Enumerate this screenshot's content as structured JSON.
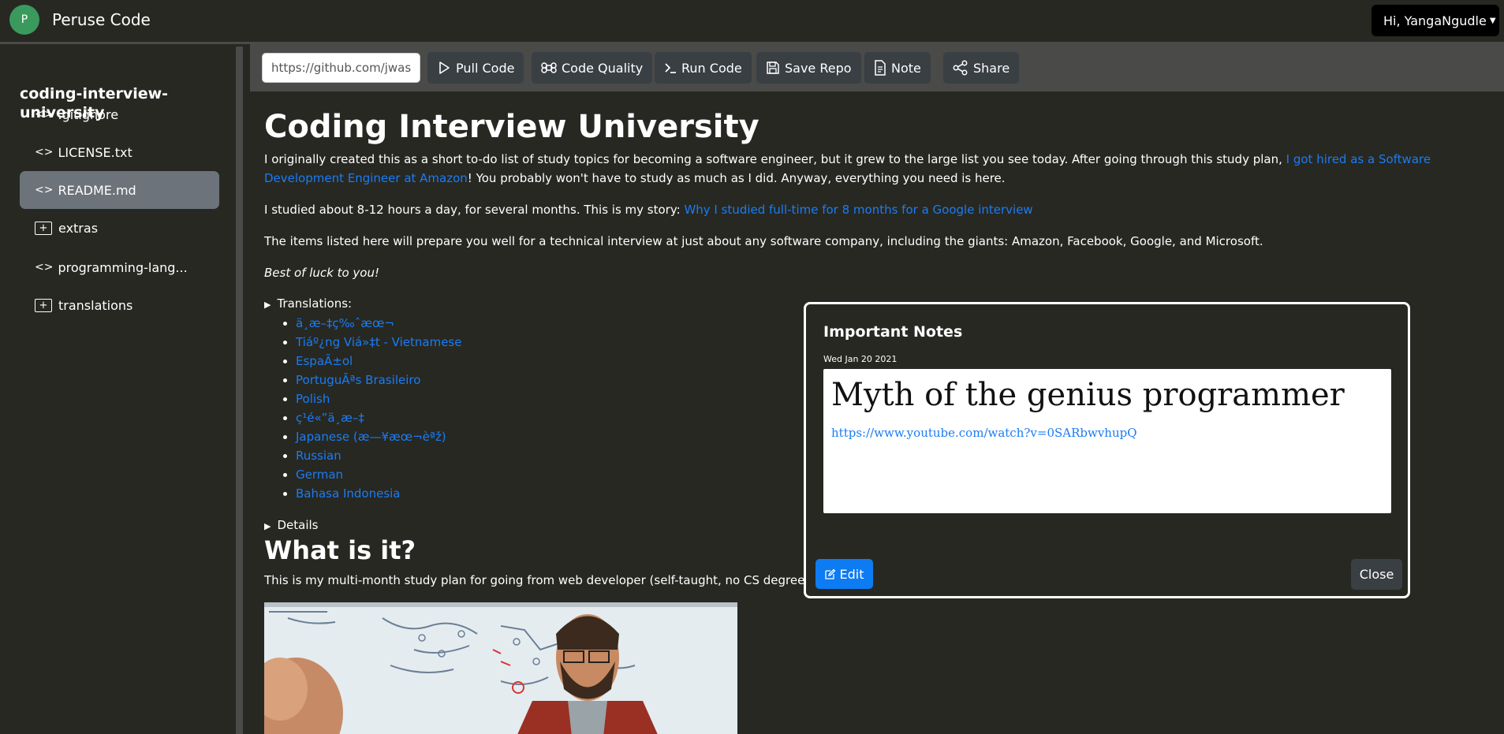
{
  "navbar": {
    "avatar_initial": "P",
    "brand": "Peruse Code",
    "user_label": "Hi, YangaNgudle"
  },
  "sidebar": {
    "repo_title": "coding-interview-university",
    "items": [
      {
        "label": ".gitignore",
        "type": "file"
      },
      {
        "label": "LICENSE.txt",
        "type": "file"
      },
      {
        "label": "README.md",
        "type": "file",
        "active": true
      },
      {
        "label": "extras",
        "type": "folder"
      },
      {
        "label": "programming-lang...",
        "type": "file"
      },
      {
        "label": "translations",
        "type": "folder"
      }
    ]
  },
  "toolbar": {
    "url_value": "https://github.com/jwasham/coding-interview-university",
    "buttons": [
      "Pull Code",
      "Code Quality",
      "Run Code",
      "Save Repo",
      "Note",
      "Share"
    ]
  },
  "readme": {
    "title": "Coding Interview University",
    "p1_text": "I originally created this as a short to-do list of study topics for becoming a software engineer, but it grew to the large list you see today. After going through this study plan, ",
    "p1_link": "I got hired as a Software Development Engineer at Amazon",
    "p1_tail": "! You probably won't have to study as much as I did. Anyway, everything you need is here.",
    "p2_text": "I studied about 8-12 hours a day, for several months. This is my story: ",
    "p2_link": "Why I studied full-time for 8 months for a Google interview",
    "p3_text": "The items listed here will prepare you well for a technical interview at just about any software company, including the giants: Amazon, Facebook, Google, and Microsoft.",
    "p4_text": "Best of luck to you!",
    "translations_summary": "Translations:",
    "translations": [
      "ä¸­æ–‡ç‰ˆæœ¬",
      "Tiáº¿ng Viá»‡t - Vietnamese",
      "EspaÃ±ol",
      "PortuguÃªs Brasileiro",
      "Polish",
      "ç¹é«”ä¸­æ–‡",
      "Japanese (æ—¥æœ¬èªž)",
      "Russian",
      "German",
      "Bahasa Indonesia"
    ],
    "details_summary": "Details",
    "h2": "What is it?",
    "p5_text": "This is my multi-month study plan for going from web developer (self-taught, no CS degree) to so"
  },
  "modal": {
    "title": "Important Notes",
    "date": "Wed Jan 20 2021",
    "note_heading": "Myth of the genius programmer",
    "note_link": "https://www.youtube.com/watch?v=0SARbwvhupQ",
    "edit_label": "Edit",
    "close_label": "Close"
  },
  "colors": {
    "background": "#272822",
    "toolbar": "#4a4a48",
    "link": "#1a7cf5",
    "primary_button": "#0d7bf2",
    "avatar": "#3a9a5e"
  }
}
